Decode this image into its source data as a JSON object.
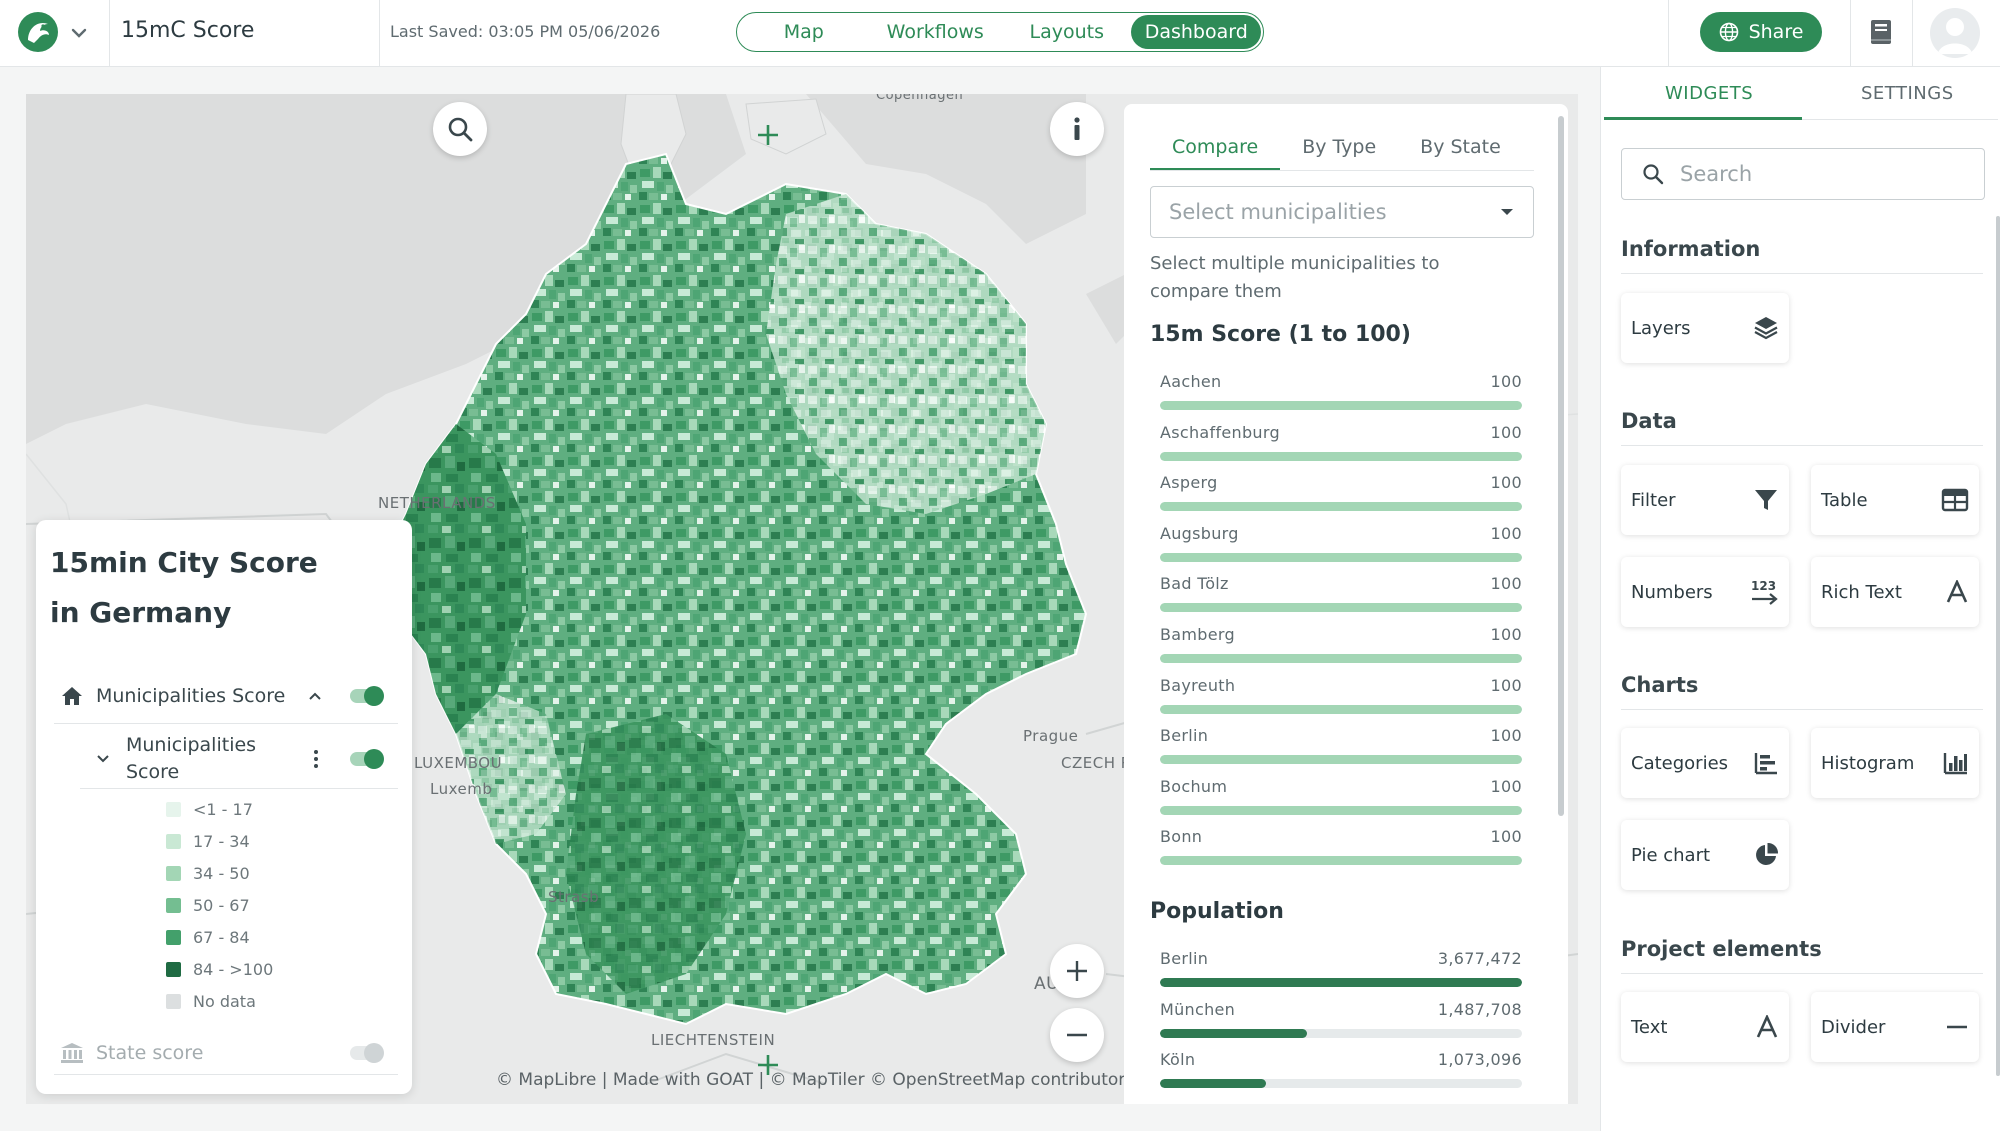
{
  "header": {
    "project_title": "15mC Score",
    "last_saved": "Last Saved: 03:05 PM 05/06/2026",
    "nav_tabs": [
      {
        "label": "Map",
        "active": false
      },
      {
        "label": "Workflows",
        "active": false
      },
      {
        "label": "Layouts",
        "active": false
      },
      {
        "label": "Dashboard",
        "active": true
      }
    ],
    "share_label": "Share",
    "icons": {
      "logo": "goat-logo-icon",
      "dropdown": "chevron-down-icon",
      "share": "globe-icon",
      "docs": "book-icon",
      "user": "avatar-icon"
    }
  },
  "map": {
    "labels": {
      "netherlands": "NETHERLANDS",
      "luxembourg": "LUXEMBOU",
      "luxembourg_city": "Luxemb",
      "prague": "Prague",
      "czech": "CZECH R",
      "strasbourg": "Strasb",
      "liechtenstein": "LIECHTENSTEIN",
      "copenhagen": "Copenhagen",
      "austria": "AU"
    },
    "attribution": "© MapLibre | Made with GOAT | © MapTiler © OpenStreetMap contributors"
  },
  "legend": {
    "title_line1": "15min City Score",
    "title_line2": "in Germany",
    "layer_group": "Municipalities Score",
    "layer": "Municipalities Score",
    "classes": [
      {
        "label": "<1 - 17",
        "color": "#e6f4ec"
      },
      {
        "label": "17 - 34",
        "color": "#c9e8d4"
      },
      {
        "label": "34 - 50",
        "color": "#a3d6b5"
      },
      {
        "label": "50 - 67",
        "color": "#74be91"
      },
      {
        "label": "67 - 84",
        "color": "#43a06b"
      },
      {
        "label": "84 - >100",
        "color": "#1f6b43"
      },
      {
        "label": "No data",
        "color": "#dcdfe0"
      }
    ],
    "state_layer": "State score"
  },
  "dashboard": {
    "tabs": [
      {
        "label": "Compare",
        "active": true
      },
      {
        "label": "By Type",
        "active": false
      },
      {
        "label": "By State",
        "active": false
      }
    ],
    "select_placeholder": "Select municipalities",
    "hint": "Select multiple municipalities to compare them",
    "score_title": "15m Score (1 to 100)",
    "score_rows": [
      {
        "name": "Aachen",
        "value": "100",
        "pct": 100
      },
      {
        "name": "Aschaffenburg",
        "value": "100",
        "pct": 100
      },
      {
        "name": "Asperg",
        "value": "100",
        "pct": 100
      },
      {
        "name": "Augsburg",
        "value": "100",
        "pct": 100
      },
      {
        "name": "Bad Tölz",
        "value": "100",
        "pct": 100
      },
      {
        "name": "Bamberg",
        "value": "100",
        "pct": 100
      },
      {
        "name": "Bayreuth",
        "value": "100",
        "pct": 100
      },
      {
        "name": "Berlin",
        "value": "100",
        "pct": 100
      },
      {
        "name": "Bochum",
        "value": "100",
        "pct": 100
      },
      {
        "name": "Bonn",
        "value": "100",
        "pct": 100
      }
    ],
    "population_title": "Population",
    "population_rows": [
      {
        "name": "Berlin",
        "value": "3,677,472",
        "pct": 100
      },
      {
        "name": "München",
        "value": "1,487,708",
        "pct": 40.5
      },
      {
        "name": "Köln",
        "value": "1,073,096",
        "pct": 29.2
      }
    ],
    "colors": {
      "score_bar": "#a3d6b5",
      "population_bar": "#2f7a52"
    }
  },
  "sidebar": {
    "tabs": [
      {
        "label": "WIDGETS",
        "active": true
      },
      {
        "label": "SETTINGS",
        "active": false
      }
    ],
    "search_placeholder": "Search",
    "sections": {
      "information": "Information",
      "data": "Data",
      "charts": "Charts",
      "project": "Project elements"
    },
    "widgets": {
      "layers": "Layers",
      "filter": "Filter",
      "table": "Table",
      "numbers": "Numbers",
      "rich_text": "Rich Text",
      "categories": "Categories",
      "histogram": "Histogram",
      "pie_chart": "Pie chart",
      "text": "Text",
      "divider": "Divider"
    }
  },
  "accent_color": "#2e8b57"
}
